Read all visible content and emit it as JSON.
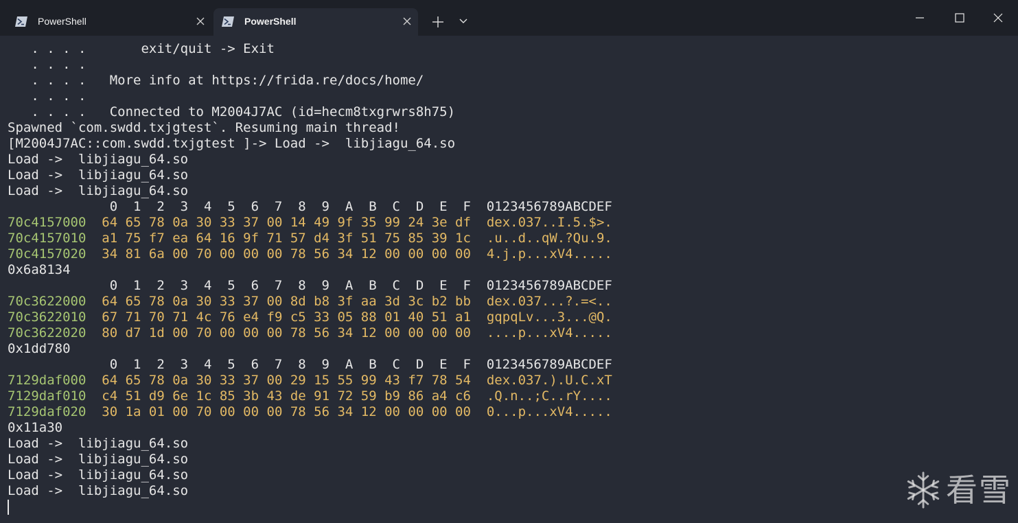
{
  "tabs": [
    {
      "label": "PowerShell",
      "active": false,
      "icon": "powershell-icon"
    },
    {
      "label": "PowerShell",
      "active": true,
      "icon": "powershell-icon"
    }
  ],
  "window": {
    "new_tab_icon": "plus-icon",
    "dropdown_icon": "chevron-down-icon"
  },
  "colors": {
    "background": "#272b35",
    "titlebar": "#1d2027",
    "address": "#a6c572",
    "hexdata": "#e3b964",
    "text": "#e6e6e6"
  },
  "terminal": {
    "banner": [
      {
        "dots": "   . . . .",
        "text": "       exit/quit -> Exit"
      },
      {
        "dots": "   . . . .",
        "text": ""
      },
      {
        "dots": "   . . . .",
        "text": "   More info at https://frida.re/docs/home/"
      },
      {
        "dots": "   . . . .",
        "text": ""
      },
      {
        "dots": "   . . . .",
        "text": "   Connected to M2004J7AC (id=hecm8txgrwrs8h75)"
      }
    ],
    "spawned": "Spawned `com.swdd.txjgtest`. Resuming main thread!",
    "prompt_line": "[M2004J7AC::com.swdd.txjgtest ]-> Load ->  libjiagu_64.so",
    "loads_before": [
      "Load ->  libjiagu_64.so",
      "Load ->  libjiagu_64.so",
      "Load ->  libjiagu_64.so"
    ],
    "dumps": [
      {
        "header": "             0  1  2  3  4  5  6  7  8  9  A  B  C  D  E  F  0123456789ABCDEF",
        "rows": [
          {
            "addr": "70c4157000",
            "hex": "64 65 78 0a 30 33 37 00 14 49 9f 35 99 24 3e df",
            "ascii": "dex.037..I.5.$>."
          },
          {
            "addr": "70c4157010",
            "hex": "a1 75 f7 ea 64 16 9f 71 57 d4 3f 51 75 85 39 1c",
            "ascii": ".u..d..qW.?Qu.9."
          },
          {
            "addr": "70c4157020",
            "hex": "34 81 6a 00 70 00 00 00 78 56 34 12 00 00 00 00",
            "ascii": "4.j.p...xV4....."
          }
        ],
        "size": "0x6a8134"
      },
      {
        "header": "             0  1  2  3  4  5  6  7  8  9  A  B  C  D  E  F  0123456789ABCDEF",
        "rows": [
          {
            "addr": "70c3622000",
            "hex": "64 65 78 0a 30 33 37 00 8d b8 3f aa 3d 3c b2 bb",
            "ascii": "dex.037...?.=<.."
          },
          {
            "addr": "70c3622010",
            "hex": "67 71 70 71 4c 76 e4 f9 c5 33 05 88 01 40 51 a1",
            "ascii": "gqpqLv...3...@Q."
          },
          {
            "addr": "70c3622020",
            "hex": "80 d7 1d 00 70 00 00 00 78 56 34 12 00 00 00 00",
            "ascii": "....p...xV4....."
          }
        ],
        "size": "0x1dd780"
      },
      {
        "header": "             0  1  2  3  4  5  6  7  8  9  A  B  C  D  E  F  0123456789ABCDEF",
        "rows": [
          {
            "addr": "7129daf000",
            "hex": "64 65 78 0a 30 33 37 00 29 15 55 99 43 f7 78 54",
            "ascii": "dex.037.).U.C.xT"
          },
          {
            "addr": "7129daf010",
            "hex": "c4 51 d9 6e 1c 85 3b 43 de 91 72 59 b9 86 a4 c6",
            "ascii": ".Q.n..;C..rY...."
          },
          {
            "addr": "7129daf020",
            "hex": "30 1a 01 00 70 00 00 00 78 56 34 12 00 00 00 00",
            "ascii": "0...p...xV4....."
          }
        ],
        "size": "0x11a30"
      }
    ],
    "loads_after": [
      "Load ->  libjiagu_64.so",
      "Load ->  libjiagu_64.so",
      "Load ->  libjiagu_64.so",
      "Load ->  libjiagu_64.so"
    ]
  },
  "watermark": {
    "text": "看雪",
    "icon": "snowflake-logo"
  }
}
